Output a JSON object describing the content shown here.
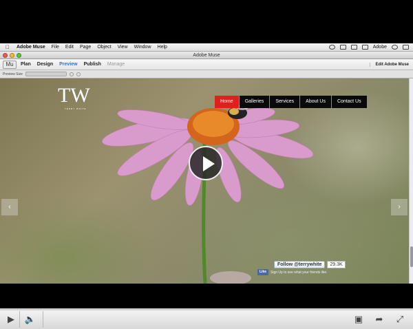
{
  "menubar": {
    "app_name": "Adobe Muse",
    "items": [
      "File",
      "Edit",
      "Page",
      "Object",
      "View",
      "Window",
      "Help"
    ],
    "right_label": "Adobe"
  },
  "window": {
    "title": "Adobe Muse"
  },
  "muse_toolbar": {
    "logo": "Mu",
    "tabs": [
      {
        "label": "Plan"
      },
      {
        "label": "Design"
      },
      {
        "label": "Preview"
      },
      {
        "label": "Publish"
      },
      {
        "label": "Manage"
      }
    ],
    "site_label": "Edit Adobe Muse"
  },
  "preview": {
    "size_label": "Preview Size"
  },
  "website": {
    "logo_text": "TW",
    "logo_subtitle": "TERRY WHITE",
    "nav": [
      {
        "label": "Home"
      },
      {
        "label": "Galleries"
      },
      {
        "label": "Services"
      },
      {
        "label": "About Us"
      },
      {
        "label": "Contact Us"
      }
    ],
    "twitter_follow": "Follow @terrywhite",
    "twitter_count": "29.3K",
    "fb_like": "Like",
    "fb_text": "Sign Up to see what your friends like."
  },
  "player": {
    "progress": 0.0
  },
  "colors": {
    "accent": "#e0201d",
    "nav_bg": "#0a0a0a",
    "preview_tab": "#3a72c8"
  }
}
